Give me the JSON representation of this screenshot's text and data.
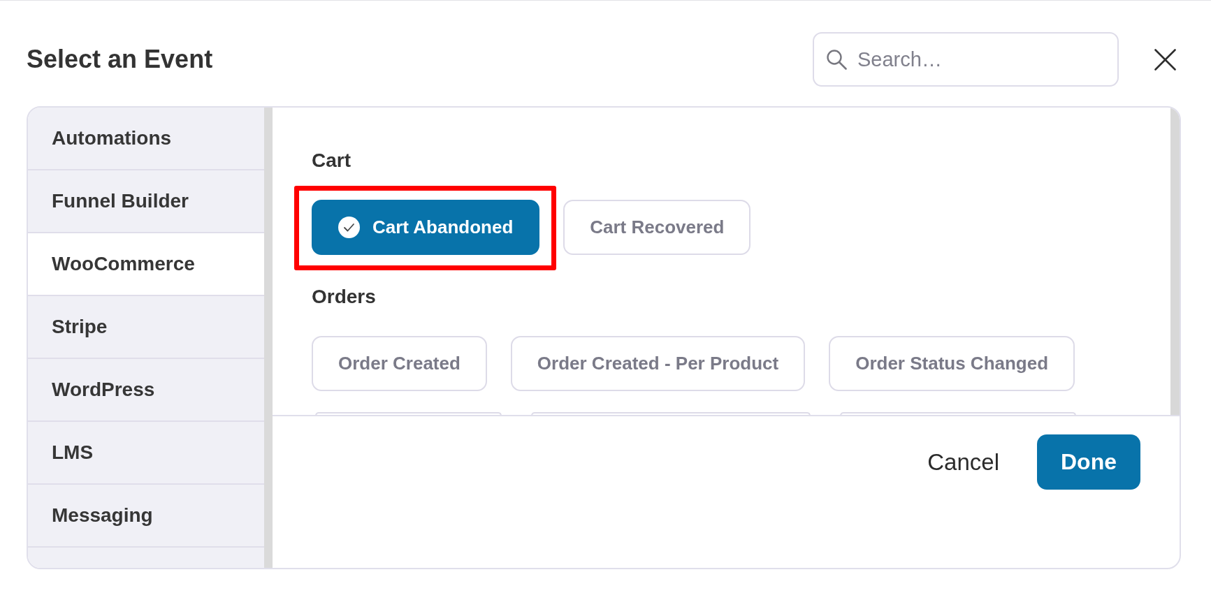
{
  "dialog": {
    "title": "Select an Event",
    "search": {
      "placeholder": "Search…"
    }
  },
  "sidebar": {
    "items": [
      {
        "label": "Automations",
        "selected": false
      },
      {
        "label": "Funnel Builder",
        "selected": false
      },
      {
        "label": "WooCommerce",
        "selected": true
      },
      {
        "label": "Stripe",
        "selected": false
      },
      {
        "label": "WordPress",
        "selected": false
      },
      {
        "label": "LMS",
        "selected": false
      },
      {
        "label": "Messaging",
        "selected": false
      }
    ]
  },
  "groups": [
    {
      "title": "Cart",
      "events": [
        {
          "kind": "option",
          "label": "Cart Abandoned",
          "selected": true,
          "highlighted": true
        },
        {
          "kind": "option",
          "label": "Cart Recovered",
          "selected": false,
          "highlighted": false
        }
      ]
    },
    {
      "title": "Orders",
      "events": [
        {
          "kind": "option",
          "label": "Order Created",
          "selected": false,
          "highlighted": false
        },
        {
          "kind": "option",
          "label": "Order Created - Per Product",
          "selected": false,
          "highlighted": false
        },
        {
          "kind": "option",
          "label": "Order Status Changed",
          "selected": false,
          "highlighted": false
        },
        {
          "kind": "clipped",
          "selected": false
        },
        {
          "kind": "clipped",
          "selected": false
        },
        {
          "kind": "clipped",
          "selected": false
        }
      ]
    }
  ],
  "footer": {
    "buttons": [
      {
        "kind": "text",
        "label": "Cancel"
      },
      {
        "kind": "primary",
        "label": "Done"
      }
    ]
  }
}
